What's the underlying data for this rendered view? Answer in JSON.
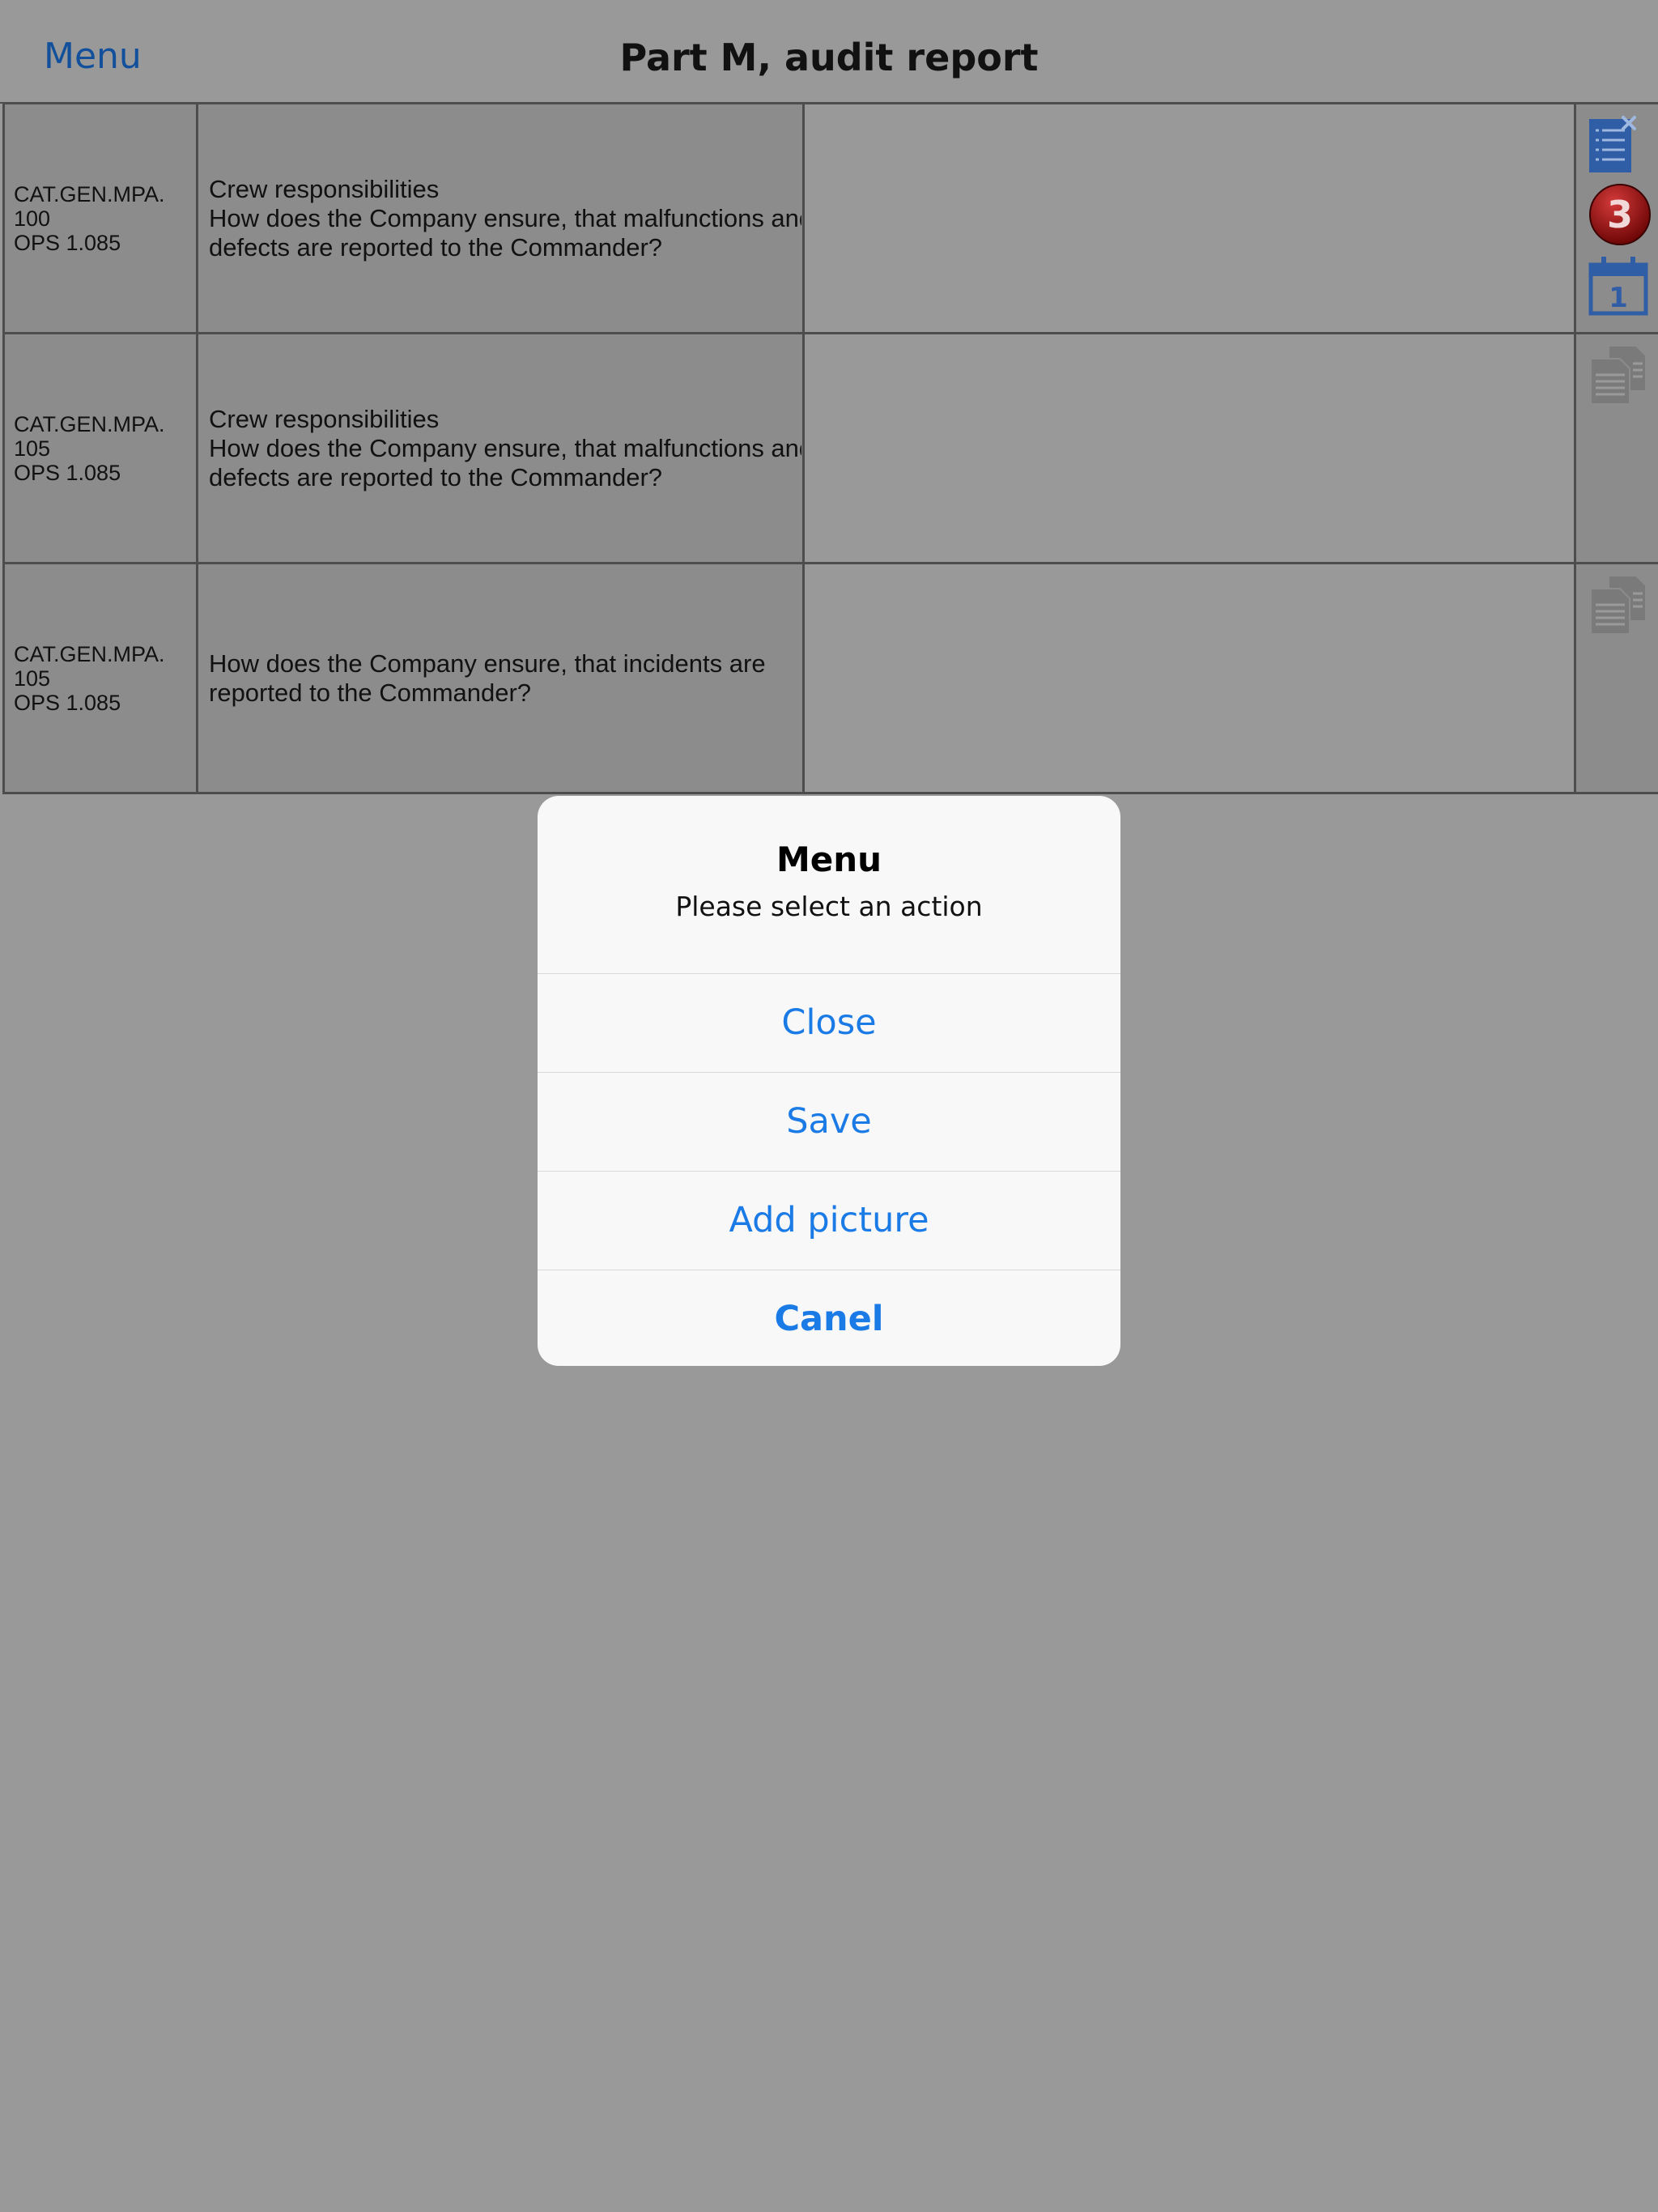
{
  "nav": {
    "menu_label": "Menu",
    "title": "Part M, audit report"
  },
  "rows": [
    {
      "ref": [
        "CAT.GEN.MPA.",
        "100",
        "OPS 1.085"
      ],
      "question": [
        "Crew responsibilities",
        "How does the Company ensure, that malfunctions and",
        "defects are reported to the Commander?"
      ],
      "answer": ""
    },
    {
      "ref": [
        "CAT.GEN.MPA.",
        "105",
        "OPS 1.085"
      ],
      "question": [
        "Crew responsibilities",
        "How does the Company ensure, that malfunctions and",
        "defects are reported to the Commander?"
      ],
      "answer": ""
    },
    {
      "ref": [
        "CAT.GEN.MPA.",
        "105",
        "OPS 1.085"
      ],
      "question": [
        "How does the Company ensure, that incidents are",
        "reported to the Commander?"
      ],
      "answer": ""
    }
  ],
  "row_icons": {
    "badge_count": "3",
    "calendar_day": "1",
    "list_icon": "list-remove-icon",
    "doc_icon": "documents-icon",
    "calendar_icon": "calendar-icon"
  },
  "dialog": {
    "title": "Menu",
    "message": "Please select an action",
    "actions": [
      "Close",
      "Save",
      "Add picture",
      "Canel"
    ]
  },
  "colors": {
    "link_blue": "#1a7ae6",
    "nav_blue": "#12509c",
    "badge_red": "#9b0b0b",
    "icon_blue": "#2f5da6"
  }
}
